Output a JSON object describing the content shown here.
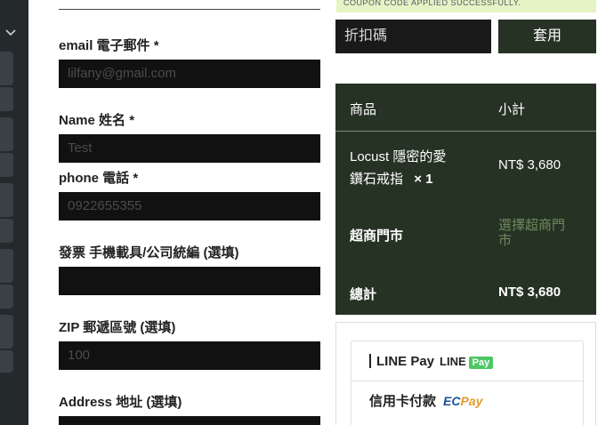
{
  "notice": {
    "text": "COUPON CODE APPLIED SUCCESSFULLY."
  },
  "form": {
    "email": {
      "label": "email 電子郵件 *",
      "placeholder": "lilfany@gmail.com"
    },
    "name": {
      "label": "Name 姓名 *",
      "placeholder": "Test"
    },
    "phone": {
      "label": "phone 電話 *",
      "placeholder": "0922655355"
    },
    "invoice": {
      "label": "發票 手機載具/公司統編 (選填)",
      "placeholder": ""
    },
    "zip": {
      "label": "ZIP 郵遞區號 (選填)",
      "placeholder": "100"
    },
    "address": {
      "label": "Address 地址 (選填)",
      "placeholder": ""
    }
  },
  "coupon": {
    "placeholder": "折扣碼",
    "apply_label": "套用"
  },
  "summary": {
    "col_product": "商品",
    "col_subtotal": "小計",
    "item_name_line1": "Locust 隱密的愛",
    "item_name_line2": "鑽石戒指",
    "item_qty": "× 1",
    "item_price": "NT$ 3,680",
    "shipping_label": "超商門市",
    "shipping_action_line1": "選擇超商門",
    "shipping_action_line2": "市",
    "total_label": "總計",
    "total_value": "NT$ 3,680"
  },
  "payments": {
    "linepay_label": "LINE Pay",
    "linepay_logo_text": "LINE",
    "linepay_logo_badge": "Pay",
    "card_label": "信用卡付款",
    "ecpay_ec": "EC",
    "ecpay_pay": "Pay"
  },
  "colors": {
    "dark_green": "#263224",
    "muted_green": "#6f8a5e",
    "notice_bg": "#e4f4c4"
  }
}
